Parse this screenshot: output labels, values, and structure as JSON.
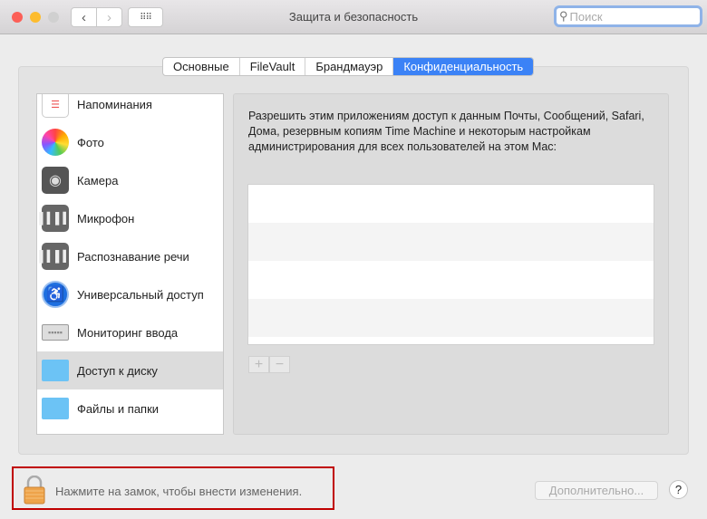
{
  "window": {
    "title": "Защита и безопасность",
    "search_placeholder": "Поиск"
  },
  "tabs": [
    {
      "label": "Основные"
    },
    {
      "label": "FileVault"
    },
    {
      "label": "Брандмауэр"
    },
    {
      "label": "Конфиденциальность",
      "active": true
    }
  ],
  "sidebar": {
    "items": [
      {
        "label": "Напоминания",
        "icon": "reminders-icon"
      },
      {
        "label": "Фото",
        "icon": "photos-icon"
      },
      {
        "label": "Камера",
        "icon": "camera-icon"
      },
      {
        "label": "Микрофон",
        "icon": "microphone-icon"
      },
      {
        "label": "Распознавание речи",
        "icon": "speech-recognition-icon"
      },
      {
        "label": "Универсальный доступ",
        "icon": "accessibility-icon"
      },
      {
        "label": "Мониторинг ввода",
        "icon": "keyboard-icon"
      },
      {
        "label": "Доступ к диску",
        "icon": "folder-icon",
        "selected": true
      },
      {
        "label": "Файлы и папки",
        "icon": "folder-icon"
      }
    ]
  },
  "main": {
    "description": "Разрешить этим приложениям доступ к данным Почты, Сообщений, Safari, Дома, резервным копиям Time Machine и некоторым настройкам администрирования для всех пользователей на этом Mac:",
    "add": "+",
    "remove": "−"
  },
  "footer": {
    "lock_text": "Нажмите на замок, чтобы внести изменения.",
    "advanced": "Дополнительно...",
    "help": "?"
  }
}
